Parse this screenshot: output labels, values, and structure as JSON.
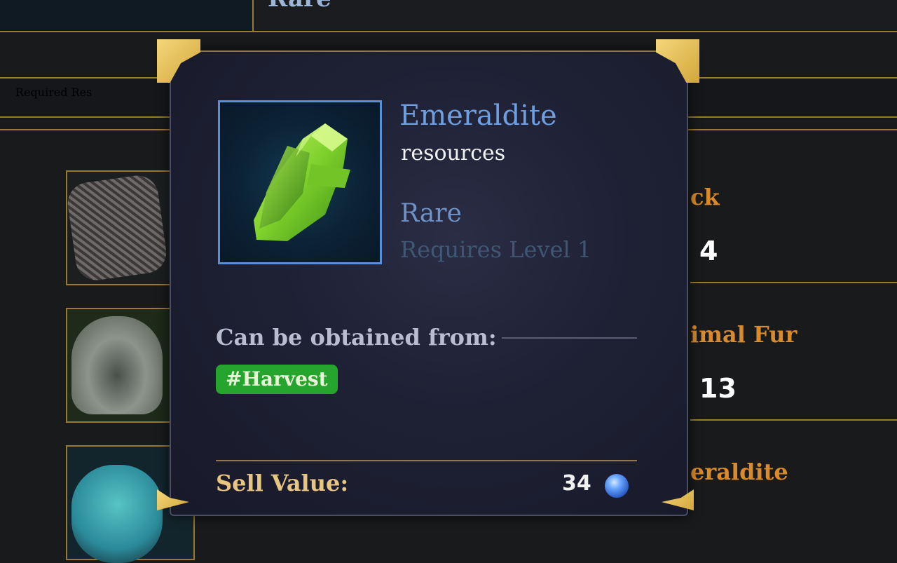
{
  "background": {
    "top_title": "Rare",
    "required_header": "Required Res",
    "materials": [
      {
        "name": "ck",
        "qty": "4"
      },
      {
        "name": "imal Fur",
        "qty": "13"
      },
      {
        "name": "eraldite",
        "qty": ""
      }
    ]
  },
  "tooltip": {
    "item_name": "Emeraldite",
    "item_type": "resources",
    "rarity": "Rare",
    "requirement": "Requires Level 1",
    "obtain_label": "Can be obtained from:",
    "obtain_tags": [
      "#Harvest"
    ],
    "sell_label": "Sell Value:",
    "sell_value": "34",
    "icon_name": "emeraldite-crystal-icon",
    "currency_icon": "gem-currency-icon"
  },
  "colors": {
    "item_name": "#6f9fe0",
    "rarity": "#6d93c8",
    "tag_bg": "#25a42e",
    "sell_label": "#e8c581",
    "material_name": "#d98a2a",
    "gold_accent": "#d3a63a"
  }
}
